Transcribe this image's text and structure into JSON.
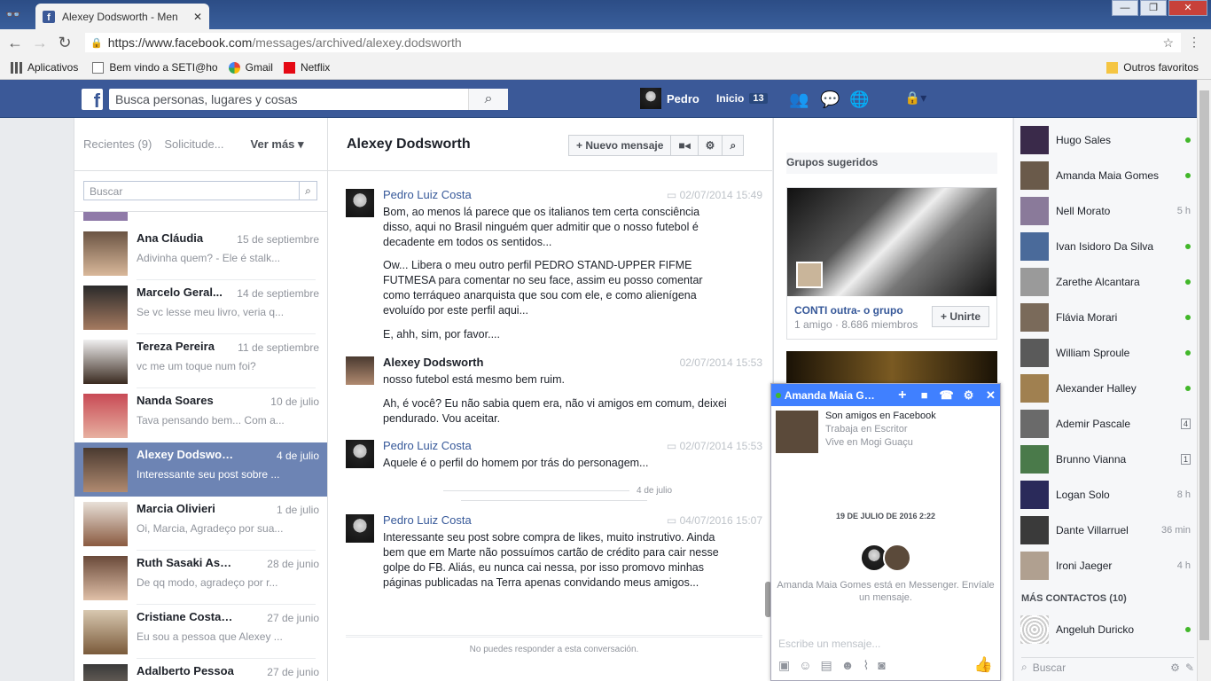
{
  "browser": {
    "tab_title": "Alexey Dodsworth - Men",
    "tab_close": "✕",
    "url_main": "https://www.facebook.com",
    "url_path": "/messages/archived/alexey.dodsworth",
    "window_controls": [
      "—",
      "❐",
      "✕"
    ],
    "bookmarks": [
      "Aplicativos",
      "Bem vindo a SETI@ho",
      "Gmail",
      "Netflix"
    ],
    "other_favorites": "Outros favoritos"
  },
  "fb": {
    "logo": "f",
    "search_placeholder": "Busca personas, lugares y cosas",
    "profile_name": "Pedro",
    "home_label": "Inicio",
    "home_count": "13"
  },
  "left": {
    "tab_recent": "Recientes",
    "tab_recent_count": "(9)",
    "tab_requests": "Solicitude...",
    "see_more": "Ver más ▾",
    "search_placeholder": "Buscar",
    "threads": [
      {
        "name": "Ana Cláudia",
        "date": "15 de septiembre",
        "snippet": "Adivinha quem? - Ele é stalk..."
      },
      {
        "name": "Marcelo Geral...",
        "date": "14 de septiembre",
        "snippet": "Se vc lesse meu livro, veria q..."
      },
      {
        "name": "Tereza Pereira",
        "date": "11 de septiembre",
        "snippet": "vc me um toque num foi?"
      },
      {
        "name": "Nanda Soares",
        "date": "10 de julio",
        "snippet": "Tava pensando bem... Com a..."
      },
      {
        "name": "Alexey Dodsworth",
        "date": "4 de julio",
        "snippet": "Interessante seu post sobre ..."
      },
      {
        "name": "Marcia Olivieri",
        "date": "1 de julio",
        "snippet": "Oi, Marcia, Agradeço por sua..."
      },
      {
        "name": "Ruth Sasaki Astrolo...",
        "date": "28 de junio",
        "snippet": "De qq modo, agradeço por r..."
      },
      {
        "name": "Cristiane Costa Cruz",
        "date": "27 de junio",
        "snippet": "Eu sou a pessoa que Alexey ..."
      },
      {
        "name": "Adalberto Pessoa",
        "date": "27 de junio",
        "snippet": ""
      }
    ]
  },
  "conversation": {
    "title": "Alexey Dodsworth",
    "new_message": "+ Nuevo mensaje",
    "messages": [
      {
        "author": "Pedro Luiz Costa",
        "time": "02/07/2014 15:49",
        "paragraphs": [
          "Bom, ao menos lá parece que os italianos tem certa consciência disso, aqui no Brasil ninguém quer admitir que o nosso futebol é decadente em todos os sentidos...",
          "Ow... Libera o meu outro perfil PEDRO STAND-UPPER FIFME FUTMESA para comentar no seu face, assim eu posso comentar como terráqueo anarquista que sou com ele, e como alienígena evoluído por este perfil aqui...",
          "E, ahh, sim, por favor...."
        ]
      },
      {
        "author": "Alexey Dodsworth",
        "time": "02/07/2014 15:53",
        "paragraphs": [
          "nosso futebol está mesmo bem ruim.",
          "Ah, é você? Eu não sabia quem era, não vi amigos em comum, deixei pendurado. Vou aceitar."
        ]
      },
      {
        "author": "Pedro Luiz Costa",
        "time": "02/07/2014 15:53",
        "paragraphs": [
          "Aquele é o perfil do homem por trás do personagem..."
        ]
      },
      {
        "author": "Pedro Luiz Costa",
        "time": "04/07/2016 15:07",
        "paragraphs": [
          "Interessante seu post sobre compra de likes, muito instrutivo. Ainda bem que em Marte não possuímos cartão de crédito para cair nesse golpe do FB. Aliás, eu nunca cai nessa, por isso promovo minhas páginas publicadas na Terra apenas convidando meus amigos..."
        ]
      }
    ],
    "date_divider": "4 de julio",
    "no_reply": "No puedes responder a esta conversación."
  },
  "groups": {
    "title": "Grupos sugeridos",
    "name": "CONTI outra- o grupo",
    "meta": "1 amigo · 8.686 miembros",
    "join": "+ Unirte"
  },
  "chat": {
    "name": "Amanda Maia Go...",
    "info1": "Son amigos en Facebook",
    "info2": "Trabaja en Escritor",
    "info3": "Vive en Mogi Guaçu",
    "date": "19 DE JULIO DE 2016 2:22",
    "note": "Amanda Maia Gomes está en Messenger. Envíale un mensaje.",
    "input_placeholder": "Escribe un mensaje..."
  },
  "sidebar": {
    "contacts": [
      {
        "name": "Hugo Sales",
        "status": "online"
      },
      {
        "name": "Amanda Maia Gomes",
        "status": "online"
      },
      {
        "name": "Nell Morato",
        "status": "5 h"
      },
      {
        "name": "Ivan Isidoro Da Silva",
        "status": "online"
      },
      {
        "name": "Zarethe Alcantara",
        "status": "online"
      },
      {
        "name": "Flávia Morari",
        "status": "online"
      },
      {
        "name": "William Sproule",
        "status": "online"
      },
      {
        "name": "Alexander Halley",
        "status": "online"
      },
      {
        "name": "Ademir Pascale",
        "status": "4"
      },
      {
        "name": "Brunno Vianna",
        "status": "1"
      },
      {
        "name": "Logan Solo",
        "status": "8 h"
      },
      {
        "name": "Dante Villarruel",
        "status": "36 min"
      },
      {
        "name": "Ironi Jaeger",
        "status": "4 h"
      }
    ],
    "more_contacts": "MÁS CONTACTOS (10)",
    "extra_contact": "Angeluh Duricko",
    "search_placeholder": "Buscar"
  }
}
